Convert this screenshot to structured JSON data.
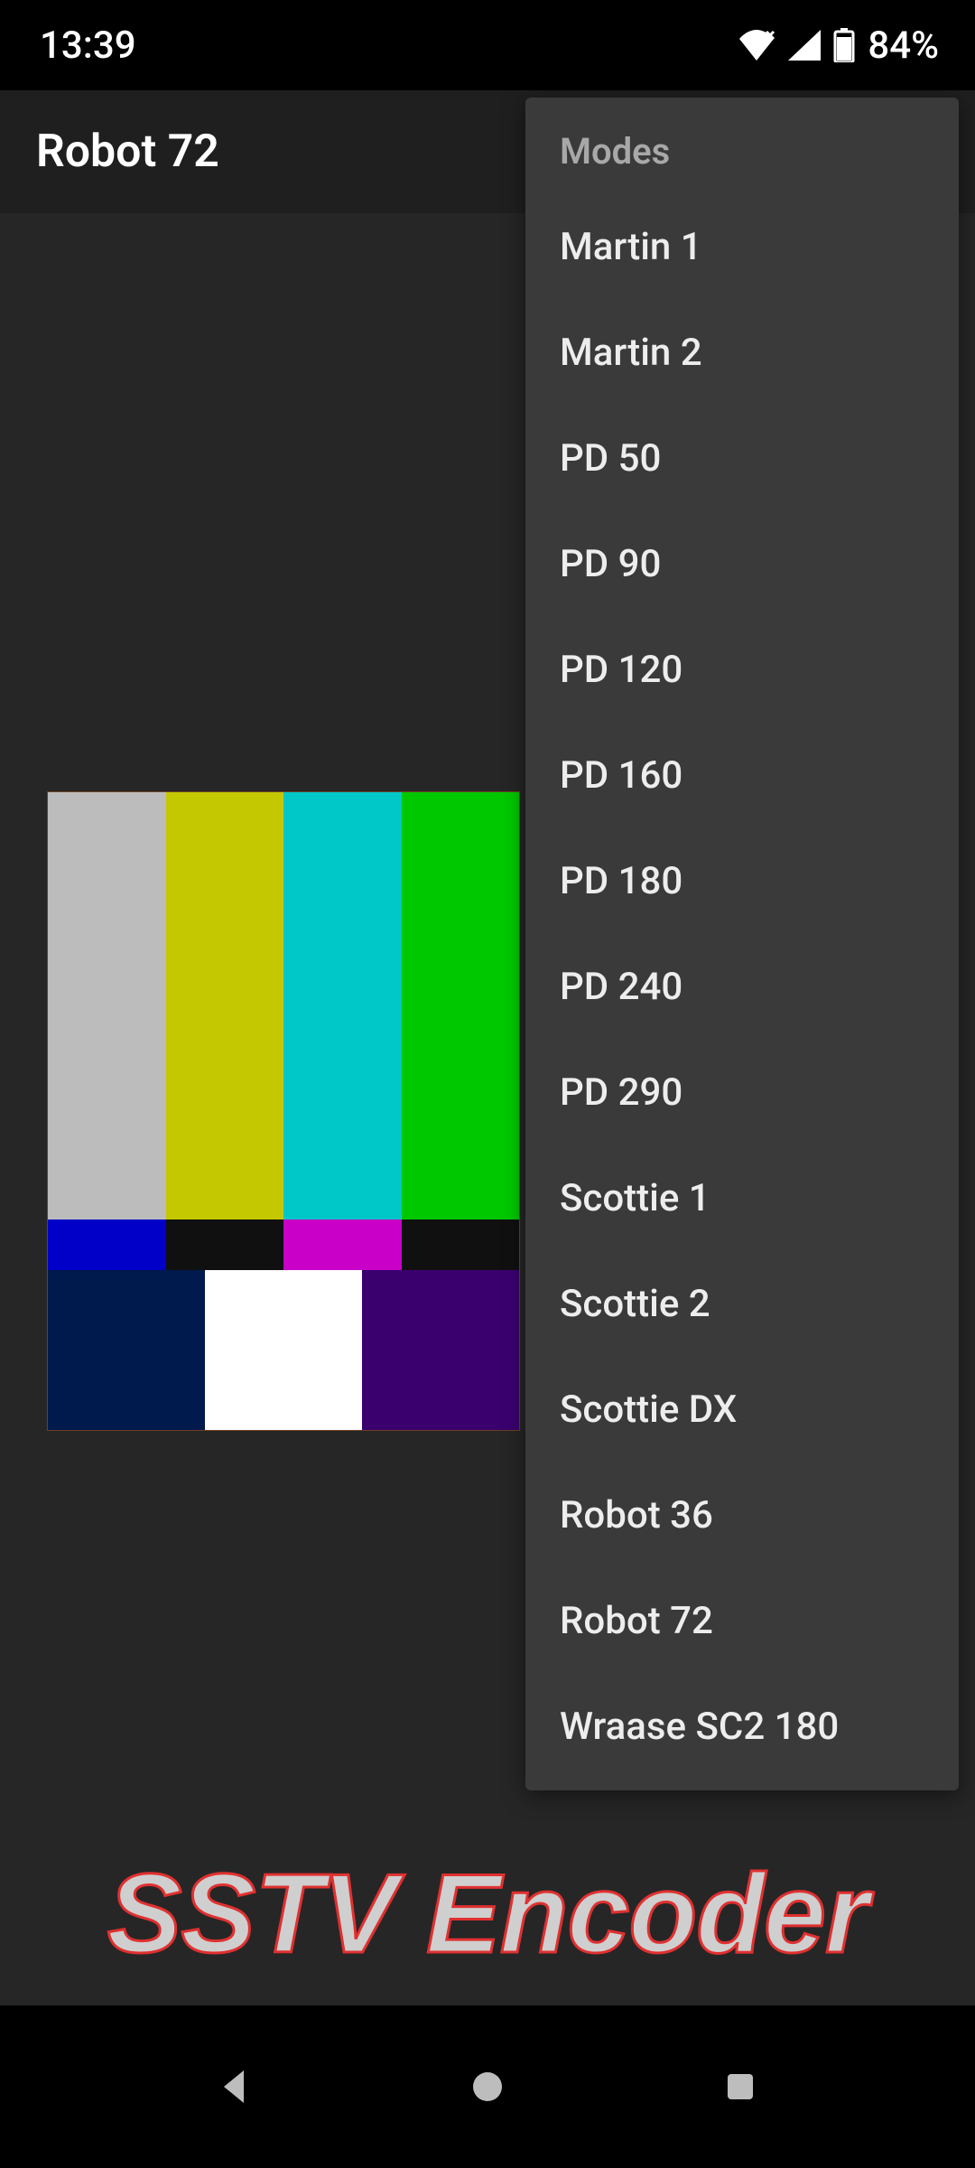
{
  "status": {
    "time": "13:39",
    "battery_pct": "84%"
  },
  "appbar": {
    "title": "Robot 72"
  },
  "menu": {
    "header": "Modes",
    "items": [
      "Martin 1",
      "Martin 2",
      "PD 50",
      "PD 90",
      "PD 120",
      "PD 160",
      "PD 180",
      "PD 240",
      "PD 290",
      "Scottie 1",
      "Scottie 2",
      "Scottie DX",
      "Robot 36",
      "Robot 72",
      "Wraase SC2 180"
    ]
  },
  "footer": {
    "title": "SSTV Encoder"
  },
  "colors": {
    "bars_top": [
      "#bcbcbc",
      "#c4c800",
      "#00c8c8",
      "#00c800"
    ],
    "bars_mid": [
      "#0000c8",
      "#101010",
      "#c800c8",
      "#101010"
    ],
    "bars_bot": [
      "#001a4d",
      "#ffffff",
      "#3a006e"
    ]
  }
}
